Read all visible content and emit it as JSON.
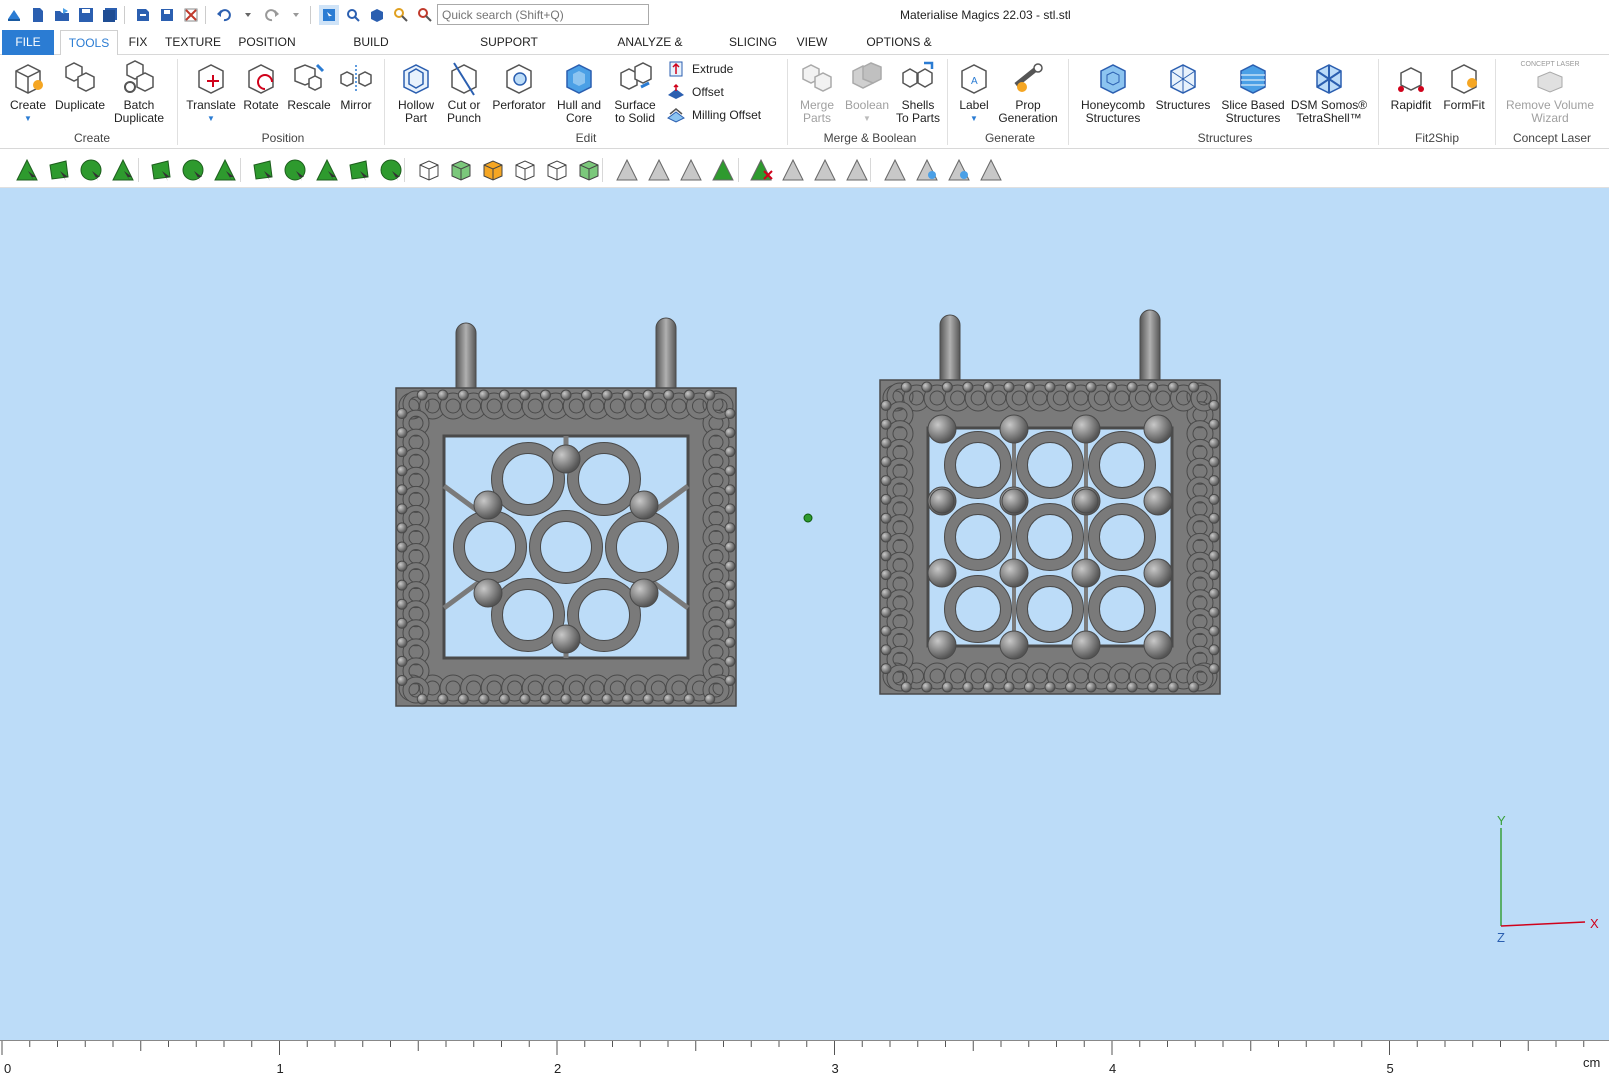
{
  "window": {
    "title": "Materialise Magics 22.03 - stl.stl"
  },
  "search": {
    "placeholder": "Quick search (Shift+Q)"
  },
  "tabs": [
    {
      "label": "FILE"
    },
    {
      "label": "TOOLS"
    },
    {
      "label": "FIX"
    },
    {
      "label": "TEXTURE"
    },
    {
      "label": "POSITION"
    },
    {
      "label": "BUILD PREPARATION"
    },
    {
      "label": "SUPPORT GENERATION"
    },
    {
      "label": "ANALYZE & REPORT"
    },
    {
      "label": "SLICING"
    },
    {
      "label": "VIEW"
    },
    {
      "label": "OPTIONS & HELP"
    }
  ],
  "active_tab": "TOOLS",
  "ribbon": {
    "create": {
      "create_label": "Create",
      "duplicate_label": "Duplicate",
      "batch_label_1": "Batch",
      "batch_label_2": "Duplicate",
      "group_label": "Create"
    },
    "position": {
      "translate_label": "Translate",
      "rotate_label": "Rotate",
      "rescale_label": "Rescale",
      "mirror_label": "Mirror",
      "group_label": "Position"
    },
    "edit": {
      "hollow_1": "Hollow",
      "hollow_2": "Part",
      "cut_1": "Cut or",
      "cut_2": "Punch",
      "perforator": "Perforator",
      "hull_1": "Hull and",
      "hull_2": "Core",
      "surface_1": "Surface",
      "surface_2": "to Solid",
      "extrude": "Extrude",
      "offset": "Offset",
      "milling_offset": "Milling Offset",
      "group_label": "Edit"
    },
    "merge": {
      "merge_1": "Merge",
      "merge_2": "Parts",
      "boolean": "Boolean",
      "shells_1": "Shells",
      "shells_2": "To Parts",
      "group_label": "Merge & Boolean"
    },
    "generate": {
      "label": "Label",
      "prop_1": "Prop",
      "prop_2": "Generation",
      "group_label": "Generate"
    },
    "structures": {
      "honeycomb_1": "Honeycomb",
      "honeycomb_2": "Structures",
      "structures": "Structures",
      "slice_1": "Slice Based",
      "slice_2": "Structures",
      "dsm_1": "DSM Somos®",
      "dsm_2": "TetraShell™",
      "group_label": "Structures"
    },
    "fit2ship": {
      "rapidfit": "Rapidfit",
      "formfit": "FormFit",
      "group_label": "Fit2Ship"
    },
    "concept": {
      "logo_text": "CONCEPT LASER",
      "remove_1": "Remove Volume",
      "remove_2": "Wizard",
      "group_label": "Concept Laser"
    }
  },
  "toolbar_icons": [
    "triangle-mark-icon",
    "surface-mark-icon",
    "curved-surface-mark-icon",
    "shell-mark-icon",
    "plane-mark-icon",
    "sphere-mark-icon",
    "curve-mark-icon",
    "box-mark-icon",
    "brush-mark-icon",
    "flower-mark-icon",
    "circle-mark-icon",
    "half-sphere-mark-icon",
    "part-mark-icon",
    "shell-select-icon",
    "colored-part-icon",
    "unmark-part-icon",
    "part-settings-icon",
    "extend-mark-icon",
    "triangle-select-icon",
    "edge-select-icon",
    "connect-select-icon",
    "surface-select-icon",
    "unmark-icon",
    "invert-mark-icon",
    "expand-mark-icon",
    "shrink-mark-icon",
    "triangle-outline-icon",
    "wave-mark-icon",
    "eye-mark-icon",
    "shade-mark-icon"
  ],
  "ruler": {
    "labels": [
      "0",
      "1",
      "2",
      "3",
      "4",
      "5"
    ],
    "unit": "cm"
  },
  "axes": {
    "x": "X",
    "y": "Y",
    "z": "Z"
  },
  "colors": {
    "viewport": "#bcdcf8",
    "accent": "#2b7cd3",
    "part": "#7a7a7a",
    "mark_green": "#2e9a2e"
  }
}
